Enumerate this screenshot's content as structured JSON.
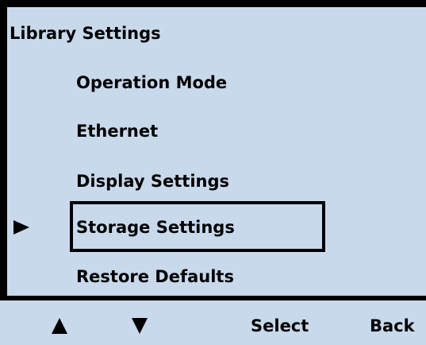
{
  "screen": {
    "title": "Library Settings",
    "background_color": "#c9d9ec",
    "items": [
      {
        "label": "Operation Mode",
        "selected": false
      },
      {
        "label": "Ethernet",
        "selected": false
      },
      {
        "label": "Display Settings",
        "selected": false
      },
      {
        "label": "Storage Settings",
        "selected": true
      },
      {
        "label": "Restore Defaults",
        "selected": false
      }
    ],
    "pointer_icon": "right-triangle-pointer"
  },
  "softkeys": {
    "up_icon": "up-arrow-icon",
    "down_icon": "down-arrow-icon",
    "select_label": "Select",
    "back_label": "Back"
  }
}
